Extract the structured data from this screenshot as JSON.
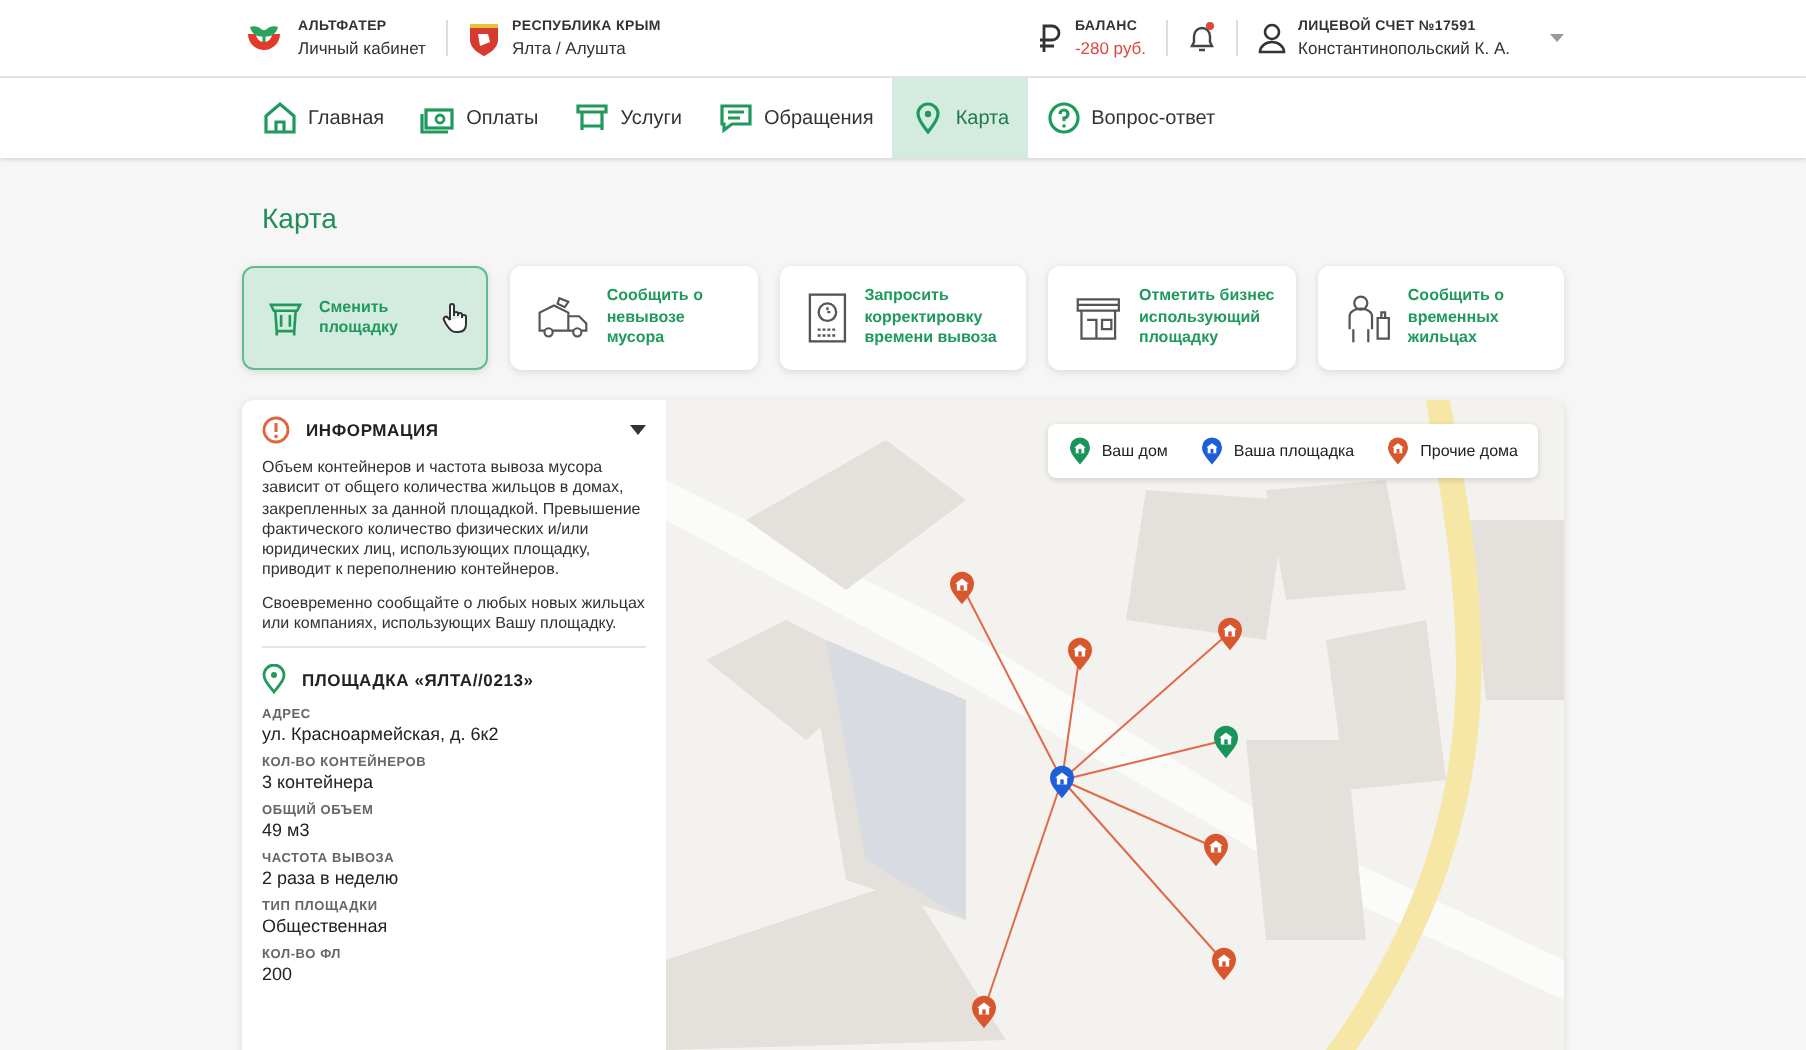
{
  "header": {
    "brand": {
      "name": "АЛЬТФАТЕР",
      "subtitle": "Личный кабинет"
    },
    "region": {
      "name": "РЕСПУБЛИКА КРЫМ",
      "subtitle": "Ялта / Алушта"
    },
    "balance": {
      "label": "БАЛАНС",
      "value": "-280 руб."
    },
    "notifications": {
      "unread": true
    },
    "account": {
      "label": "ЛИЦЕВОЙ СЧЕТ №17591",
      "name": "Константинопольский К. А."
    }
  },
  "nav": [
    {
      "label": "Главная",
      "kind": "home",
      "selected": false
    },
    {
      "label": "Оплаты",
      "kind": "payments",
      "selected": false
    },
    {
      "label": "Услуги",
      "kind": "services",
      "selected": false
    },
    {
      "label": "Обращения",
      "kind": "messages",
      "selected": false
    },
    {
      "label": "Карта",
      "kind": "map",
      "selected": true
    },
    {
      "label": "Вопрос-ответ",
      "kind": "faq",
      "selected": false
    }
  ],
  "page_title": "Карта",
  "actions": [
    {
      "label": "Сменить площадку",
      "kind": "bin",
      "selected": true
    },
    {
      "label": "Сообщить о невывозе мусора",
      "kind": "truck",
      "selected": false
    },
    {
      "label": "Запросить корректировку времени вывоза",
      "kind": "schedule",
      "selected": false
    },
    {
      "label": "Отметить бизнес использующий площадку",
      "kind": "shop",
      "selected": false
    },
    {
      "label": "Сообщить о временных жильцах",
      "kind": "tenant",
      "selected": false
    }
  ],
  "info": {
    "title": "ИНФОРМАЦИЯ",
    "expanded": true,
    "paragraphs": [
      "Объем контейнеров и частота вывоза мусора зависит от общего количества жильцов в домах, закрепленных за данной площадкой. Превышение фактического количество физических и/или юридических лиц, использующих площадку, приводит к переполнению контейнеров.",
      "Своевременно сообщайте о любых новых жильцах или компаниях, использующих Вашу площадку."
    ]
  },
  "site": {
    "title": "ПЛОЩАДКА «ЯЛТА//0213»",
    "fields": [
      {
        "label": "АДРЕС",
        "value": "ул. Красноармейская, д. 6к2"
      },
      {
        "label": "КОЛ-ВО КОНТЕЙНЕРОВ",
        "value": "3 контейнера"
      },
      {
        "label": "ОБЩИЙ ОБЪЕМ",
        "value": "49 м3"
      },
      {
        "label": "ЧАСТОТА ВЫВОЗА",
        "value": "2 раза в неделю"
      },
      {
        "label": "ТИП ПЛОЩАДКИ",
        "value": "Общественная"
      },
      {
        "label": "КОЛ-ВО ФЛ",
        "value": "200"
      }
    ]
  },
  "map": {
    "legend": [
      {
        "label": "Ваш дом",
        "kind": "home"
      },
      {
        "label": "Ваша площадка",
        "kind": "site"
      },
      {
        "label": "Прочие дома",
        "kind": "other"
      }
    ],
    "markers": [
      {
        "kind": "other"
      },
      {
        "kind": "other"
      },
      {
        "kind": "other"
      },
      {
        "kind": "home"
      },
      {
        "kind": "other"
      },
      {
        "kind": "other"
      },
      {
        "kind": "other"
      },
      {
        "kind": "site"
      }
    ]
  }
}
